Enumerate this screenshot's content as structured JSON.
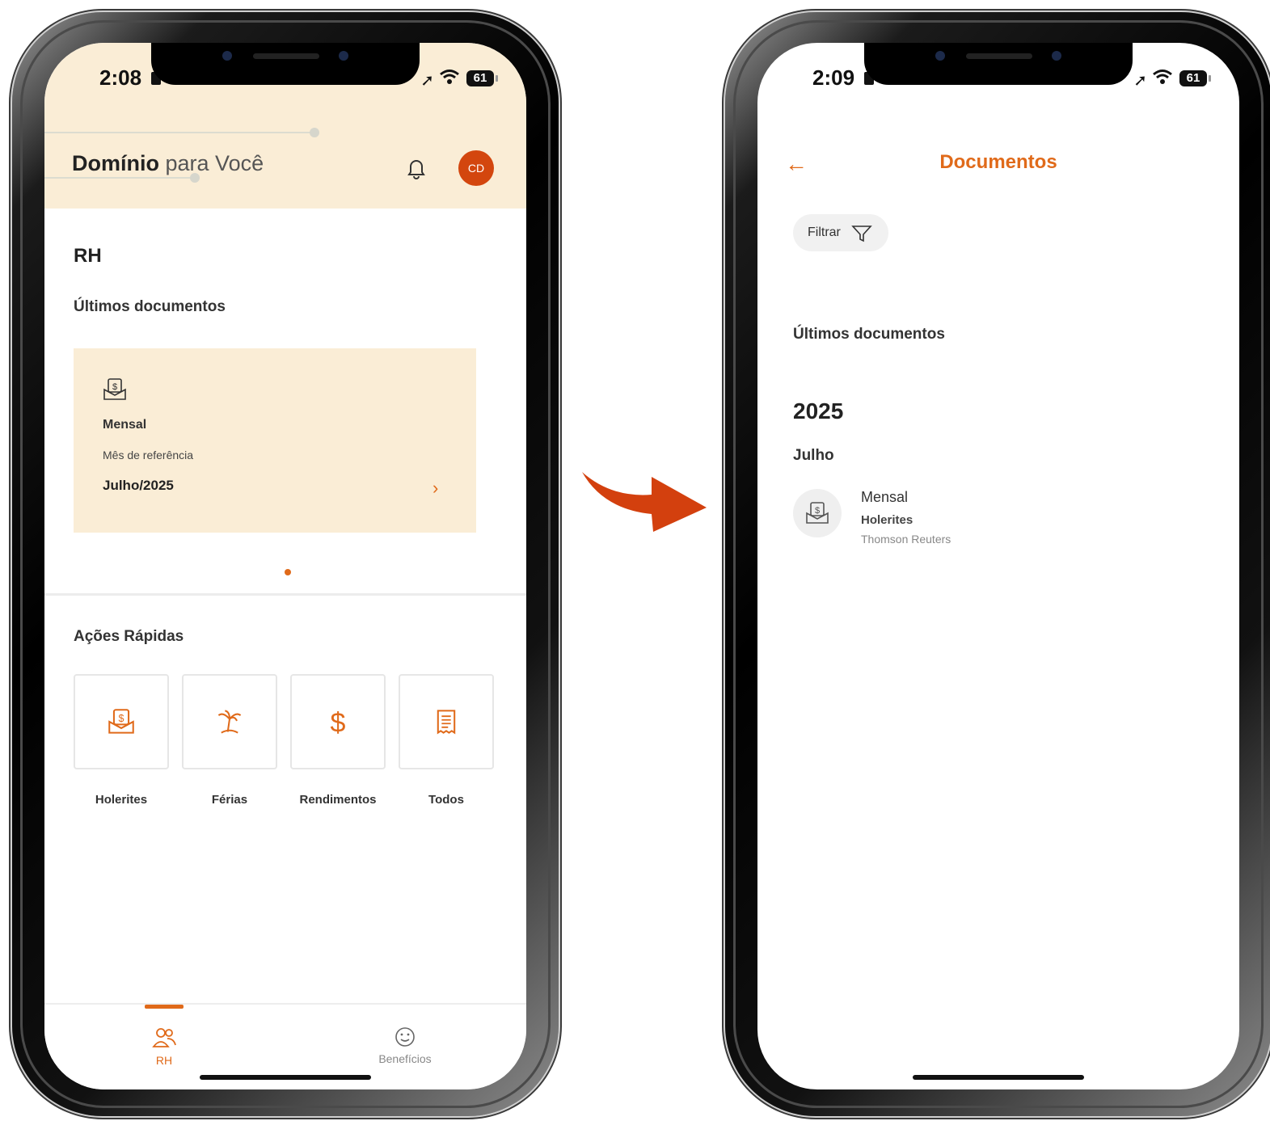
{
  "left_screen": {
    "status_bar": {
      "time": "2:08",
      "battery": "61"
    },
    "header": {
      "brand_bold": "Domínio",
      "brand_light": "para Você",
      "avatar_initials": "CD"
    },
    "page_title": "RH",
    "latest_docs": {
      "title": "Últimos documentos",
      "card": {
        "type": "Mensal",
        "ref_label": "Mês de referência",
        "ref_value": "Julho/2025"
      }
    },
    "quick_actions": {
      "title": "Ações Rápidas",
      "items": [
        {
          "label": "Holerites",
          "icon": "payslip-icon"
        },
        {
          "label": "Férias",
          "icon": "palm-tree-icon"
        },
        {
          "label": "Rendimentos",
          "icon": "dollar-icon"
        },
        {
          "label": "Todos",
          "icon": "receipt-icon"
        }
      ]
    },
    "tabs": [
      {
        "label": "RH",
        "icon": "people-icon",
        "active": true
      },
      {
        "label": "Benefícios",
        "icon": "smile-icon",
        "active": false
      }
    ]
  },
  "right_screen": {
    "status_bar": {
      "time": "2:09",
      "battery": "61"
    },
    "title": "Documentos",
    "filter_label": "Filtrar",
    "section_title": "Últimos documentos",
    "year": "2025",
    "month": "Julho",
    "item": {
      "name": "Mensal",
      "category": "Holerites",
      "company": "Thomson Reuters"
    }
  },
  "colors": {
    "accent": "#e06a1a",
    "header_bg": "#faedd6",
    "avatar": "#d3460e",
    "arrow": "#d3400e"
  }
}
